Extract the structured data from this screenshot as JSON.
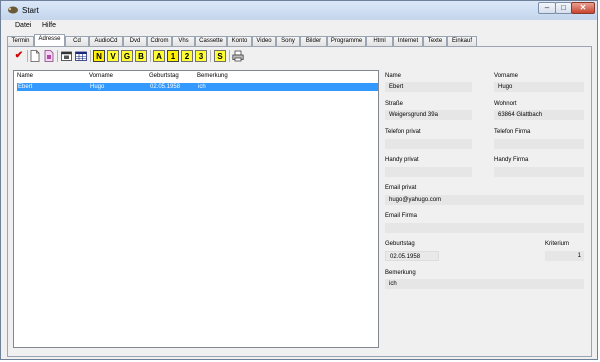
{
  "window": {
    "title": "Start"
  },
  "menu": [
    "Datei",
    "Hilfe"
  ],
  "tabs": [
    "Termin",
    "Adresse",
    "Cd",
    "AudioCd",
    "Dvd",
    "Cdrom",
    "Vhs",
    "Cassette",
    "Konto",
    "Video",
    "Sony",
    "Bilder",
    "Programme",
    "Html",
    "Internet",
    "Texte",
    "Einkauf"
  ],
  "active_tab": "Adresse",
  "toolbar": {
    "letters": [
      "N",
      "V",
      "G",
      "B",
      "A",
      "1",
      "2",
      "3",
      "S"
    ],
    "icons": [
      "checkmark-icon",
      "new-document-icon",
      "copy-document-icon",
      "window-icon",
      "grid-icon",
      "printer-icon"
    ]
  },
  "list": {
    "columns": [
      "Name",
      "Vorname",
      "Geburtstag",
      "Bemerkung"
    ],
    "rows": [
      {
        "name": "Ebert",
        "vorname": "Hugo",
        "geburtstag": "02.05.1958",
        "bemerkung": "ich"
      }
    ]
  },
  "form": {
    "name_label": "Name",
    "name_value": "Ebert",
    "vorname_label": "Vorname",
    "vorname_value": "Hugo",
    "strasse_label": "Straße",
    "strasse_value": "Weigersgrund 39a",
    "wohnort_label": "Wohnort",
    "wohnort_value": "63864 Glattbach",
    "telefon_privat_label": "Telefon privat",
    "telefon_privat_value": "",
    "telefon_firma_label": "Telefon Firma",
    "telefon_firma_value": "",
    "handy_privat_label": "Handy privat",
    "handy_privat_value": "",
    "handy_firma_label": "Handy Firma",
    "handy_firma_value": "",
    "email_privat_label": "Email privat",
    "email_privat_value": "hugo@yahugo.com",
    "email_firma_label": "Email Firma",
    "email_firma_value": "",
    "geburtstag_label": "Geburtstag",
    "geburtstag_value": "02.05.1958",
    "kriterium_label": "Kriterium",
    "kriterium_value": "1",
    "bemerkung_label": "Bemerkung",
    "bemerkung_value": "ich"
  },
  "colors": {
    "selection": "#3399ff",
    "letter_button": "#ffff33",
    "field_bg": "#e6e6e6"
  }
}
